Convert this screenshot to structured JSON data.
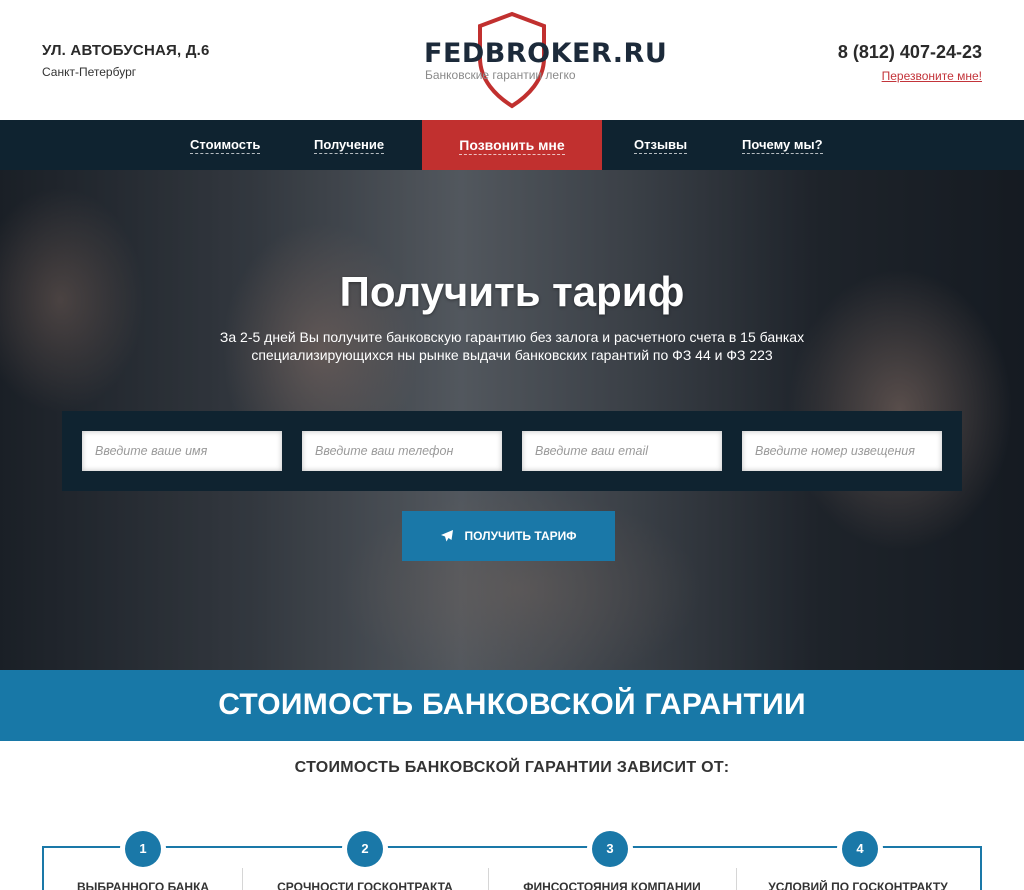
{
  "header": {
    "address_street": "УЛ. АВТОБУСНАЯ, Д.6",
    "address_city": "Санкт-Петербург",
    "logo_title": "FEDBROKER.RU",
    "logo_subtitle": "Банковские гарантии легко",
    "phone": "8 (812) 407-24-23",
    "callback_link": "Перезвоните мне!"
  },
  "nav": {
    "items": [
      {
        "label": "Стоимость"
      },
      {
        "label": "Получение"
      },
      {
        "label": "Позвонить мне"
      },
      {
        "label": "Отзывы"
      },
      {
        "label": "Почему мы?"
      }
    ]
  },
  "hero": {
    "title": "Получить тариф",
    "text_line1": "За 2-5 дней Вы получите банковскую гарантию без залога и расчетного счета в 15 банках",
    "text_line2": "специализирующихся ны рынке выдачи банковских гарантий по ФЗ 44 и ФЗ 223",
    "form": {
      "name_placeholder": "Введите ваше имя",
      "phone_placeholder": "Введите ваш телефон",
      "email_placeholder": "Введите ваш email",
      "notice_placeholder": "Введите номер извещения"
    },
    "submit_label": "ПОЛУЧИТЬ ТАРИФ"
  },
  "section": {
    "title": "СТОИМОСТЬ БАНКОВСКОЙ ГАРАНТИИ",
    "subtitle": "СТОИМОСТЬ БАНКОВСКОЙ ГАРАНТИИ ЗАВИСИТ ОТ:",
    "factors": [
      {
        "number": "1",
        "label": "ВЫБРАННОГО БАНКА"
      },
      {
        "number": "2",
        "label": "СРОЧНОСТИ ГОСКОНТРАКТА"
      },
      {
        "number": "3",
        "label": "ФИНСОСТОЯНИЯ КОМПАНИИ"
      },
      {
        "number": "4",
        "label": "УСЛОВИЙ ПО ГОСКОНТРАКТУ"
      }
    ]
  },
  "colors": {
    "accent_red": "#c1302f",
    "nav_dark": "#0f2330",
    "accent_blue": "#1878a7"
  }
}
